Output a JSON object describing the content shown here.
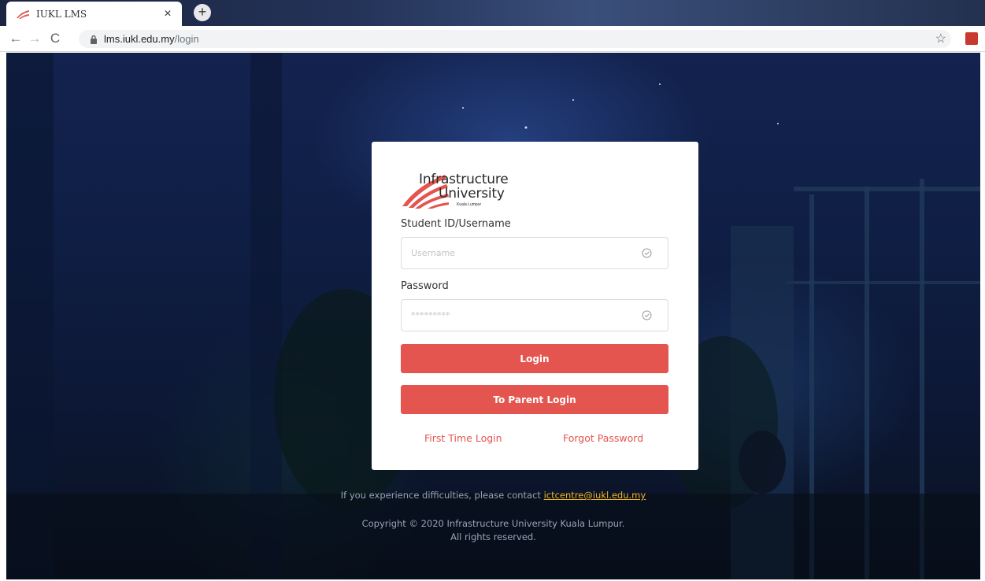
{
  "browser": {
    "tab_title": "IUKL LMS",
    "tab_close_glyph": "×",
    "new_tab_glyph": "+",
    "url_host": "lms.iukl.edu.my",
    "url_path": "/login",
    "back_glyph": "←",
    "forward_glyph": "→",
    "reload_glyph": "C",
    "star_glyph": "☆"
  },
  "login": {
    "logo_line1": "Infrastructure",
    "logo_line2": "University",
    "logo_line3": "Kuala Lumpur",
    "username_label": "Student ID/Username",
    "username_placeholder": "Username",
    "password_label": "Password",
    "password_placeholder": "*********",
    "login_button": "Login",
    "parent_login_button": "To Parent Login",
    "first_time_link": "First Time Login",
    "forgot_password_link": "Forgot Password"
  },
  "footer": {
    "contact_prefix": "If you experience difficulties, please contact ",
    "contact_email": "ictcentre@iukl.edu.my",
    "copyright_line1": "Copyright © 2020 Infrastructure University Kuala Lumpur.",
    "copyright_line2": "All rights reserved."
  },
  "colors": {
    "accent": "#e4554f",
    "link_email": "#f2b429",
    "page_bg": "#0f1e44"
  }
}
